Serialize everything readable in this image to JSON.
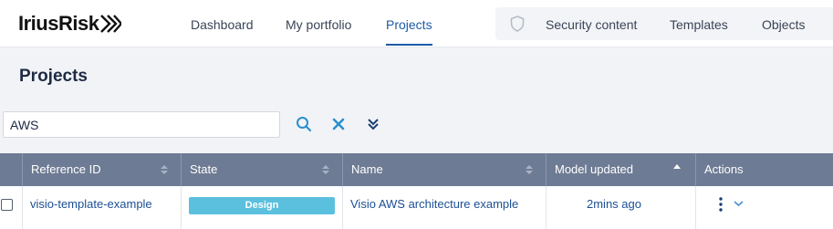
{
  "brand": {
    "name": "IriusRisk",
    "accent": "#1c5aa6",
    "logo_text": "IriusRisk"
  },
  "nav": {
    "items": [
      {
        "label": "Dashboard",
        "active": false
      },
      {
        "label": "My portfolio",
        "active": false
      },
      {
        "label": "Projects",
        "active": true
      }
    ],
    "right_items": [
      {
        "label": "Security content",
        "icon": "shield-icon"
      },
      {
        "label": "Templates"
      },
      {
        "label": "Objects"
      }
    ]
  },
  "page": {
    "title": "Projects"
  },
  "search": {
    "value": "AWS",
    "placeholder": ""
  },
  "toolbar": {
    "search_icon": "search-icon",
    "clear_icon": "close-icon",
    "expand_icon": "double-chevron-down-icon"
  },
  "table": {
    "columns": [
      {
        "label": "Reference ID",
        "sort": "unsorted"
      },
      {
        "label": "State",
        "sort": "unsorted"
      },
      {
        "label": "Name",
        "sort": "unsorted"
      },
      {
        "label": "Model updated",
        "sort": "ascending"
      },
      {
        "label": "Actions",
        "sort": "none"
      }
    ],
    "rows": [
      {
        "reference_id": "visio-template-example",
        "state": "Design",
        "state_color": "#5bc0de",
        "name": "Visio AWS architecture example",
        "model_updated": "2mins ago",
        "checked": false
      }
    ]
  }
}
